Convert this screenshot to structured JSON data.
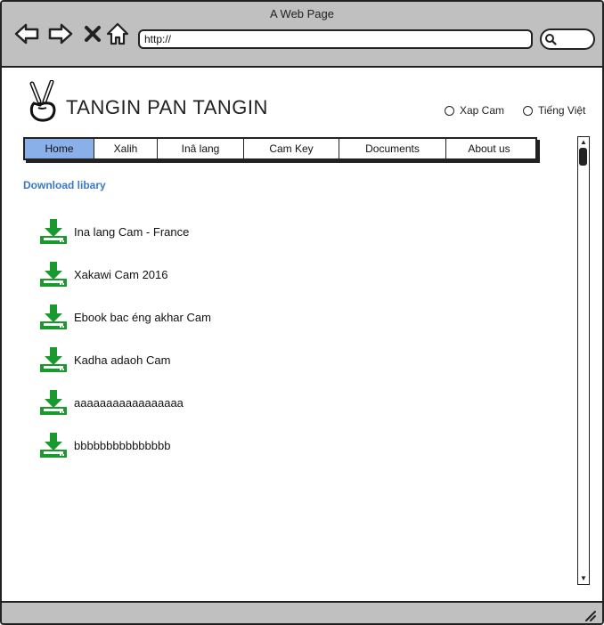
{
  "window": {
    "title": "A Web Page"
  },
  "toolbar": {
    "back_icon": "back-arrow-icon",
    "forward_icon": "forward-arrow-icon",
    "stop_icon": "close-icon",
    "home_icon": "home-icon",
    "url": "http://",
    "search_icon": "search-icon"
  },
  "header": {
    "logo_icon": "peace-hand-icon",
    "site_title": "TANGIN PAN TANGIN",
    "languages": [
      "Xap Cam",
      "Tiếng Việt"
    ]
  },
  "menu": {
    "items": [
      "Home",
      "Xalih",
      "Inâ lang",
      "Cam Key",
      "Documents",
      "About us"
    ],
    "active": "Home"
  },
  "main": {
    "section_title": "Download libary",
    "downloads": [
      "Ina lang Cam - France",
      "Xakawi Cam 2016",
      "Ebook bac éng akhar Cam",
      "Kadha adaoh Cam",
      "aaaaaaaaaaaaaaaaa",
      "bbbbbbbbbbbbbbb"
    ]
  },
  "colors": {
    "chrome": "#c0c0c0",
    "active_menu": "#8ab0ea",
    "section_title": "#3a79c9",
    "download_icon": "#1a9a2e"
  }
}
